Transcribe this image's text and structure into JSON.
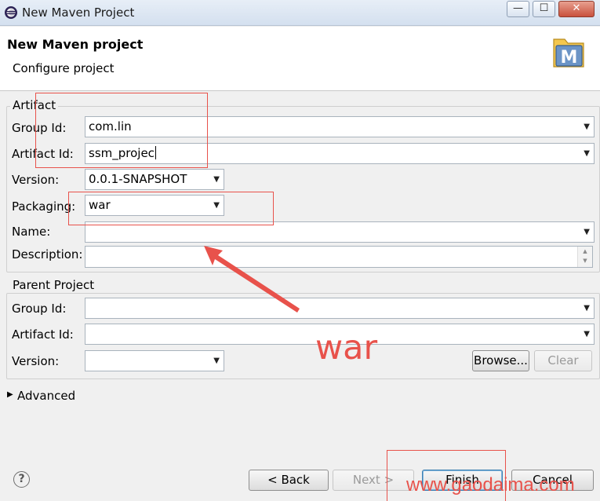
{
  "window": {
    "title": "New Maven Project",
    "controls": {
      "minimize": "—",
      "maximize": "☐",
      "close": "✕"
    }
  },
  "header": {
    "title": "New Maven project",
    "subtitle": "Configure project",
    "logo_letter": "M"
  },
  "artifact": {
    "group_label": "Artifact",
    "group_id_label": "Group Id:",
    "group_id_value": "com.lin",
    "artifact_id_label": "Artifact Id:",
    "artifact_id_value": "ssm_projec",
    "version_label": "Version:",
    "version_value": "0.0.1-SNAPSHOT",
    "packaging_label": "Packaging:",
    "packaging_value": "war",
    "name_label": "Name:",
    "name_value": "",
    "description_label": "Description:",
    "description_value": ""
  },
  "parent": {
    "group_label": "Parent Project",
    "group_id_label": "Group Id:",
    "group_id_value": "",
    "artifact_id_label": "Artifact Id:",
    "artifact_id_value": "",
    "version_label": "Version:",
    "version_value": "",
    "browse_label": "Browse...",
    "clear_label": "Clear"
  },
  "advanced": {
    "label": "Advanced"
  },
  "footer": {
    "help_icon": "?",
    "back_label": "< Back",
    "next_label": "Next >",
    "finish_label": "Finish",
    "cancel_label": "Cancel"
  },
  "annotation": {
    "text": "war",
    "color": "#e8524b"
  },
  "watermark": "www.gaodaima.com",
  "colors": {
    "annotation_red": "#e8524b",
    "focus_blue": "#3c7fb1"
  }
}
